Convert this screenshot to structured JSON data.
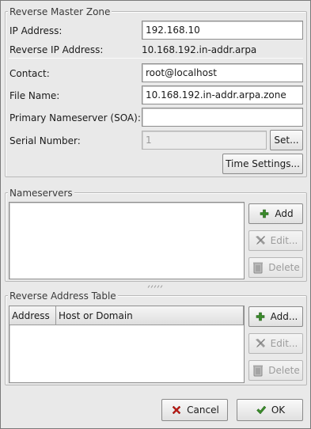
{
  "reverse_master_zone": {
    "title": "Reverse Master Zone",
    "ip_address": {
      "label": "IP Address:",
      "value": "192.168.10"
    },
    "reverse_ip": {
      "label": "Reverse IP Address:",
      "value": "10.168.192.in-addr.arpa"
    },
    "contact": {
      "label": "Contact:",
      "value": "root@localhost"
    },
    "file_name": {
      "label": "File Name:",
      "value": "10.168.192.in-addr.arpa.zone"
    },
    "primary_nameserver": {
      "label": "Primary Nameserver (SOA):",
      "value": ""
    },
    "serial_number": {
      "label": "Serial Number:",
      "value": "1"
    },
    "set_button": "Set...",
    "time_settings_button": "Time Settings..."
  },
  "nameservers": {
    "title": "Nameservers",
    "add_button": "Add",
    "edit_button": "Edit...",
    "delete_button": "Delete"
  },
  "reverse_address_table": {
    "title": "Reverse Address Table",
    "columns": [
      "Address",
      "Host or Domain"
    ],
    "add_button": "Add...",
    "edit_button": "Edit...",
    "delete_button": "Delete"
  },
  "dialog": {
    "cancel_button": "Cancel",
    "ok_button": "OK"
  },
  "icons": {
    "add": "plus-icon",
    "edit": "tools-icon",
    "delete": "trash-icon",
    "cancel": "x-icon",
    "ok": "checkmark-icon"
  },
  "colors": {
    "add_icon": "#3a8a2a",
    "cancel_icon": "#c0201a",
    "ok_icon": "#3a8a2a"
  }
}
